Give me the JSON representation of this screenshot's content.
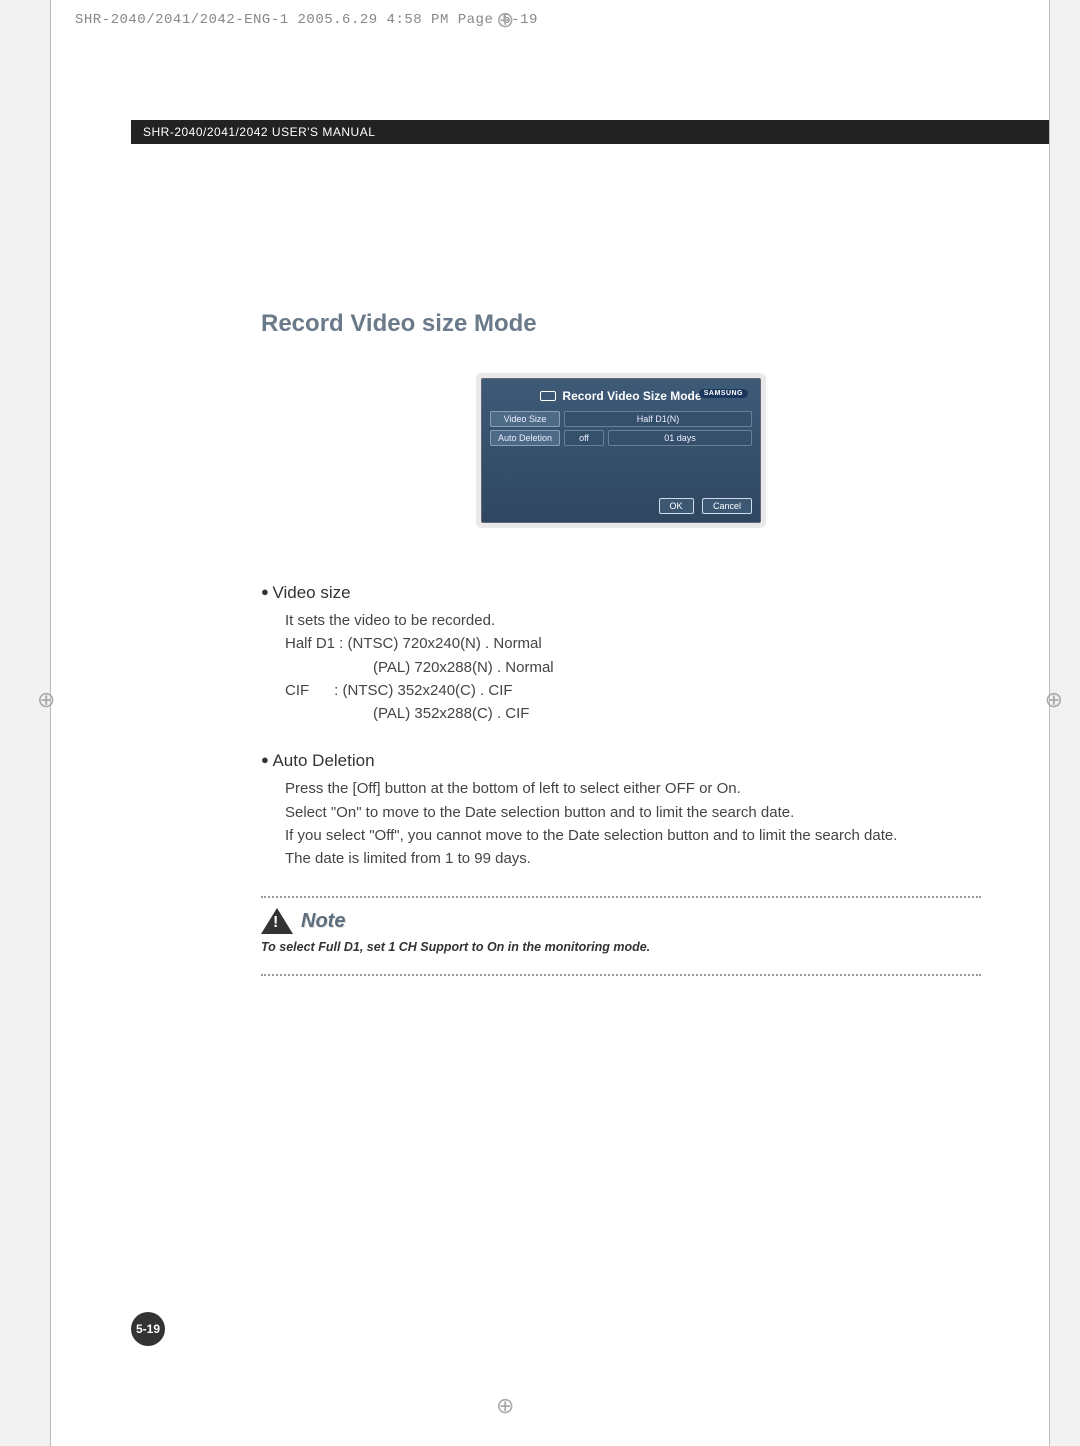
{
  "print_header": "SHR-2040/2041/2042-ENG-1  2005.6.29  4:58 PM  Page 5-19",
  "manual_header": "SHR-2040/2041/2042 USER'S MANUAL",
  "section_title": "Record Video size Mode",
  "screen": {
    "title": "Record Video Size Mode",
    "brand": "SAMSUNG",
    "rows": [
      {
        "label": "Video Size",
        "value": "Half D1(N)"
      },
      {
        "label": "Auto Deletion",
        "toggle": "off",
        "days": "01 days"
      }
    ],
    "ok": "OK",
    "cancel": "Cancel"
  },
  "video_size": {
    "heading": "Video size",
    "line1": "It sets the video to be recorded.",
    "line2": "Half D1 : (NTSC) 720x240(N) . Normal",
    "line3": "(PAL) 720x288(N) . Normal",
    "line4": "CIF      : (NTSC) 352x240(C) . CIF",
    "line5": "(PAL) 352x288(C) . CIF"
  },
  "auto_deletion": {
    "heading": "Auto Deletion",
    "line1": "Press the [Off] button at the bottom of left to select either OFF or On.",
    "line2": "Select \"On\" to move to the Date selection button and to limit the search date.",
    "line3": "If you select \"Off\", you cannot move to the Date selection button and to limit the search date.",
    "line4": "The date is limited from 1 to 99 days."
  },
  "note": {
    "label": "Note",
    "text": "To select Full D1, set 1 CH Support to On in the monitoring mode."
  },
  "page_number": "5-19"
}
